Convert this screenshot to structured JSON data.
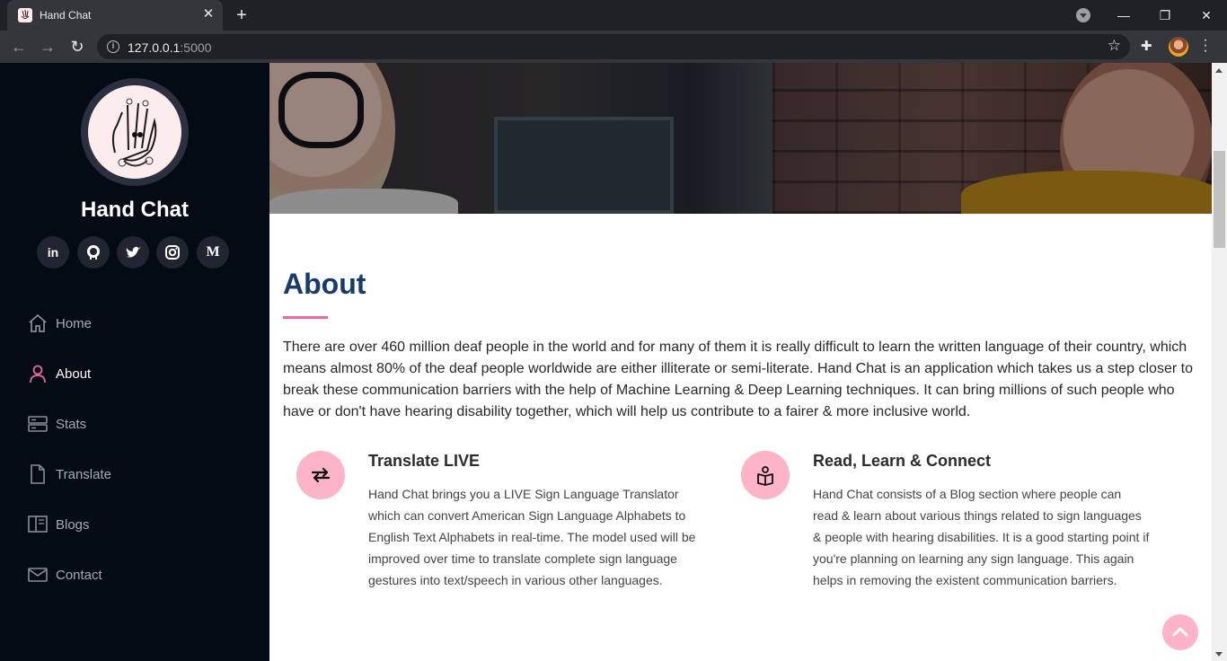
{
  "browser": {
    "tab_title": "Hand Chat",
    "tab_close": "✕",
    "new_tab": "+",
    "url_host": "127.0.0.1",
    "url_port": ":5000",
    "win_minimize": "—",
    "win_restore": "❐",
    "win_close": "✕"
  },
  "sidebar": {
    "brand": "Hand Chat",
    "socials": [
      {
        "name": "linkedin",
        "glyph": "in"
      },
      {
        "name": "github",
        "glyph": "⌥"
      },
      {
        "name": "twitter",
        "glyph": "✦"
      },
      {
        "name": "instagram",
        "glyph": "◎"
      },
      {
        "name": "medium",
        "glyph": "M"
      }
    ],
    "nav": [
      {
        "label": "Home",
        "icon": "home-icon"
      },
      {
        "label": "About",
        "icon": "person-icon",
        "active": true
      },
      {
        "label": "Stats",
        "icon": "server-icon"
      },
      {
        "label": "Translate",
        "icon": "file-icon"
      },
      {
        "label": "Blogs",
        "icon": "book-icon"
      },
      {
        "label": "Contact",
        "icon": "envelope-icon"
      }
    ]
  },
  "about": {
    "title": "About",
    "intro": "There are over 460 million deaf people in the world and for many of them it is really difficult to learn the written language of their country, which means almost 80% of the deaf people worldwide are either illiterate or semi-literate. Hand Chat is an application which takes us a step closer to break these communication barriers with the help of Machine Learning & Deep Learning techniques. It can bring millions of such people who have or don't have hearing disability together, which will help us contribute to a fairer & more inclusive world.",
    "features": [
      {
        "icon": "arrows-exchange-icon",
        "title": "Translate LIVE",
        "text": "Hand Chat brings you a LIVE Sign Language Translator which can convert American Sign Language Alphabets to English Text Alphabets in real-time. The model used will be improved over time to translate complete sign language gestures into text/speech in various other languages."
      },
      {
        "icon": "reading-person-icon",
        "title": "Read, Learn & Connect",
        "text": "Hand Chat consists of a Blog section where people can read & learn about various things related to sign languages & people with hearing disabilities. It is a good starting point if you're planning on learning any sign language. This again helps in removing the existent communication barriers."
      }
    ]
  },
  "colors": {
    "sidebar_bg": "#040b14",
    "accent_pink": "#e96b9a",
    "icon_circle": "#fcb4c6",
    "title_blue": "#173b6c"
  }
}
